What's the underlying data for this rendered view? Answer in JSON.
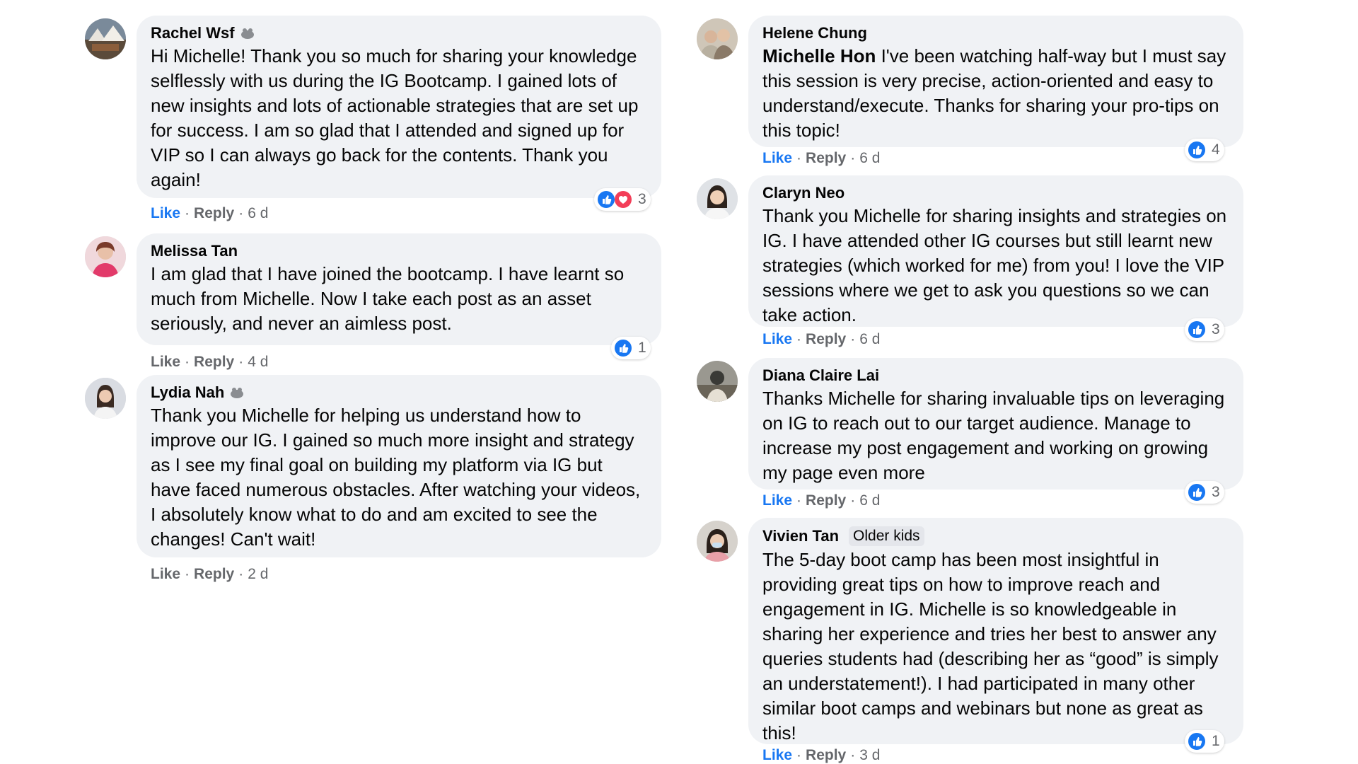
{
  "colors": {
    "like_blue": "#1877f2",
    "bubble_bg": "#f0f2f5",
    "love_red": "#f33e58"
  },
  "icons": {
    "like": "thumbs-up-icon",
    "love": "heart-icon",
    "badge": "top-fan-icon"
  },
  "comments_left": [
    {
      "author": "Rachel Wsf",
      "text": "Hi Michelle! Thank you so much for sharing your knowledge selflessly with us during the IG Bootcamp. I gained lots of new insights and lots of actionable strategies that are set up for success. I am so glad that I attended and signed up for VIP so I can always go back for the contents. Thank you again!",
      "like": "Like",
      "reply": "Reply",
      "time": "6 d",
      "reactions": "3"
    },
    {
      "author": "Melissa Tan",
      "text": "I am glad that I have joined the bootcamp. I have learnt so much from Michelle. Now I take each post as an asset seriously, and never an aimless post.",
      "like": "Like",
      "reply": "Reply",
      "time": "4 d",
      "reactions": "1"
    },
    {
      "author": "Lydia Nah",
      "text": "Thank you Michelle for helping us understand how to improve our IG. I gained so much more insight and strategy as I see my final goal on building my platform via IG but have faced numerous obstacles. After watching your videos, I absolutely know what to do and am excited to see the changes! Can't wait!",
      "like": "Like",
      "reply": "Reply",
      "time": "2 d"
    }
  ],
  "comments_right": [
    {
      "author": "Helene Chung",
      "mention": "Michelle Hon",
      "text": " I've been watching half-way but I must say this session is very precise, action-oriented and easy to understand/execute. Thanks for sharing your pro-tips on this topic!",
      "like": "Like",
      "reply": "Reply",
      "time": "6 d",
      "reactions": "4"
    },
    {
      "author": "Claryn Neo",
      "text": "Thank you Michelle for sharing insights and strategies on IG. I have attended other IG courses but still learnt new strategies (which worked for me) from you! I love the VIP sessions where we get to ask you questions so we can take action.",
      "like": "Like",
      "reply": "Reply",
      "time": "6 d",
      "reactions": "3"
    },
    {
      "author": "Diana Claire Lai",
      "text": "Thanks Michelle for sharing invaluable tips on leveraging on IG to reach out to our target audience. Manage to increase my post engagement and working on growing my page even more",
      "like": "Like",
      "reply": "Reply",
      "time": "6 d",
      "reactions": "3"
    },
    {
      "author": "Vivien Tan",
      "tag": "Older kids",
      "text": "The 5-day boot camp has been most insightful in providing great tips on how to improve reach and engagement in IG. Michelle is so knowledgeable in sharing her experience and tries her best to answer any queries students had (describing her as “good” is simply an understatement!). I had participated in many other similar boot camps and webinars but none as great as this!",
      "like": "Like",
      "reply": "Reply",
      "time": "3 d",
      "reactions": "1"
    }
  ]
}
